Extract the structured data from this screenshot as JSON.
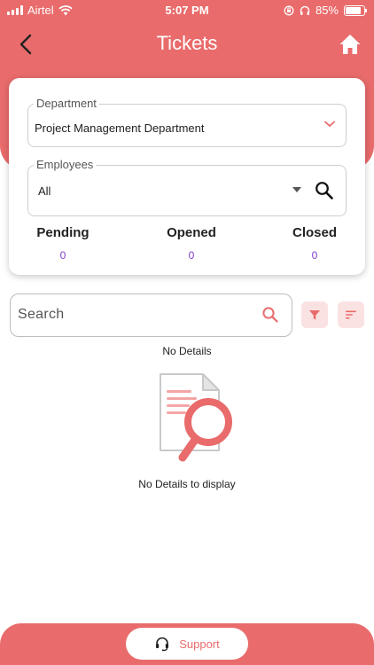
{
  "status_bar": {
    "carrier": "Airtel",
    "time": "5:07 PM",
    "battery": "85%",
    "battery_level": 0.85
  },
  "header": {
    "title": "Tickets"
  },
  "filters": {
    "department": {
      "label": "Department",
      "value": "Project Management Department"
    },
    "employees": {
      "label": "Employees",
      "value": "All"
    }
  },
  "stats": [
    {
      "label": "Pending",
      "count": "0"
    },
    {
      "label": "Opened",
      "count": "0"
    },
    {
      "label": "Closed",
      "count": "0"
    }
  ],
  "search": {
    "placeholder": "Search"
  },
  "empty_state": {
    "heading": "No Details",
    "message": "No Details to display"
  },
  "footer": {
    "support_label": "Support"
  },
  "colors": {
    "accent": "#E96B6B",
    "count": "#7E3FCB",
    "button_bg": "#FBE2E2"
  },
  "icons": [
    "signal-icon",
    "wifi-icon",
    "back-arrow-icon",
    "home-icon",
    "chevron-down-icon",
    "dropdown-arrow-icon",
    "search-icon",
    "filter-icon",
    "sort-icon",
    "document-search-icon",
    "headset-icon"
  ]
}
